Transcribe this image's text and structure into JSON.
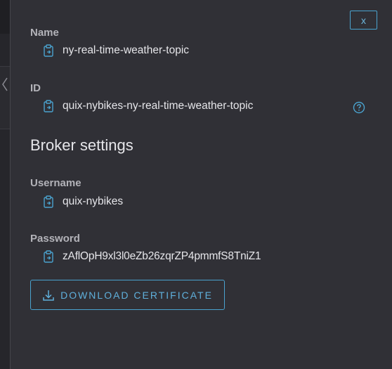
{
  "close_button": {
    "label": "x"
  },
  "fields": {
    "name": {
      "label": "Name",
      "value": "ny-real-time-weather-topic"
    },
    "id": {
      "label": "ID",
      "value": "quix-nybikes-ny-real-time-weather-topic"
    },
    "username": {
      "label": "Username",
      "value": "quix-nybikes"
    },
    "password": {
      "label": "Password",
      "value": "zAflOpH9xl3l0eZb26zqrZP4pmmfS8TniZ1"
    }
  },
  "broker_section": {
    "title": "Broker settings"
  },
  "download_button": {
    "label": "DOWNLOAD CERTIFICATE"
  },
  "icons": {
    "copy": "clipboard-copy-icon",
    "help": "help-circle-icon",
    "download": "download-icon",
    "collapse": "chevron-left-icon"
  },
  "colors": {
    "panel_bg": "#303036",
    "accent": "#4aa3cf",
    "label": "#b3b3b9",
    "text": "#e6e6ea"
  }
}
